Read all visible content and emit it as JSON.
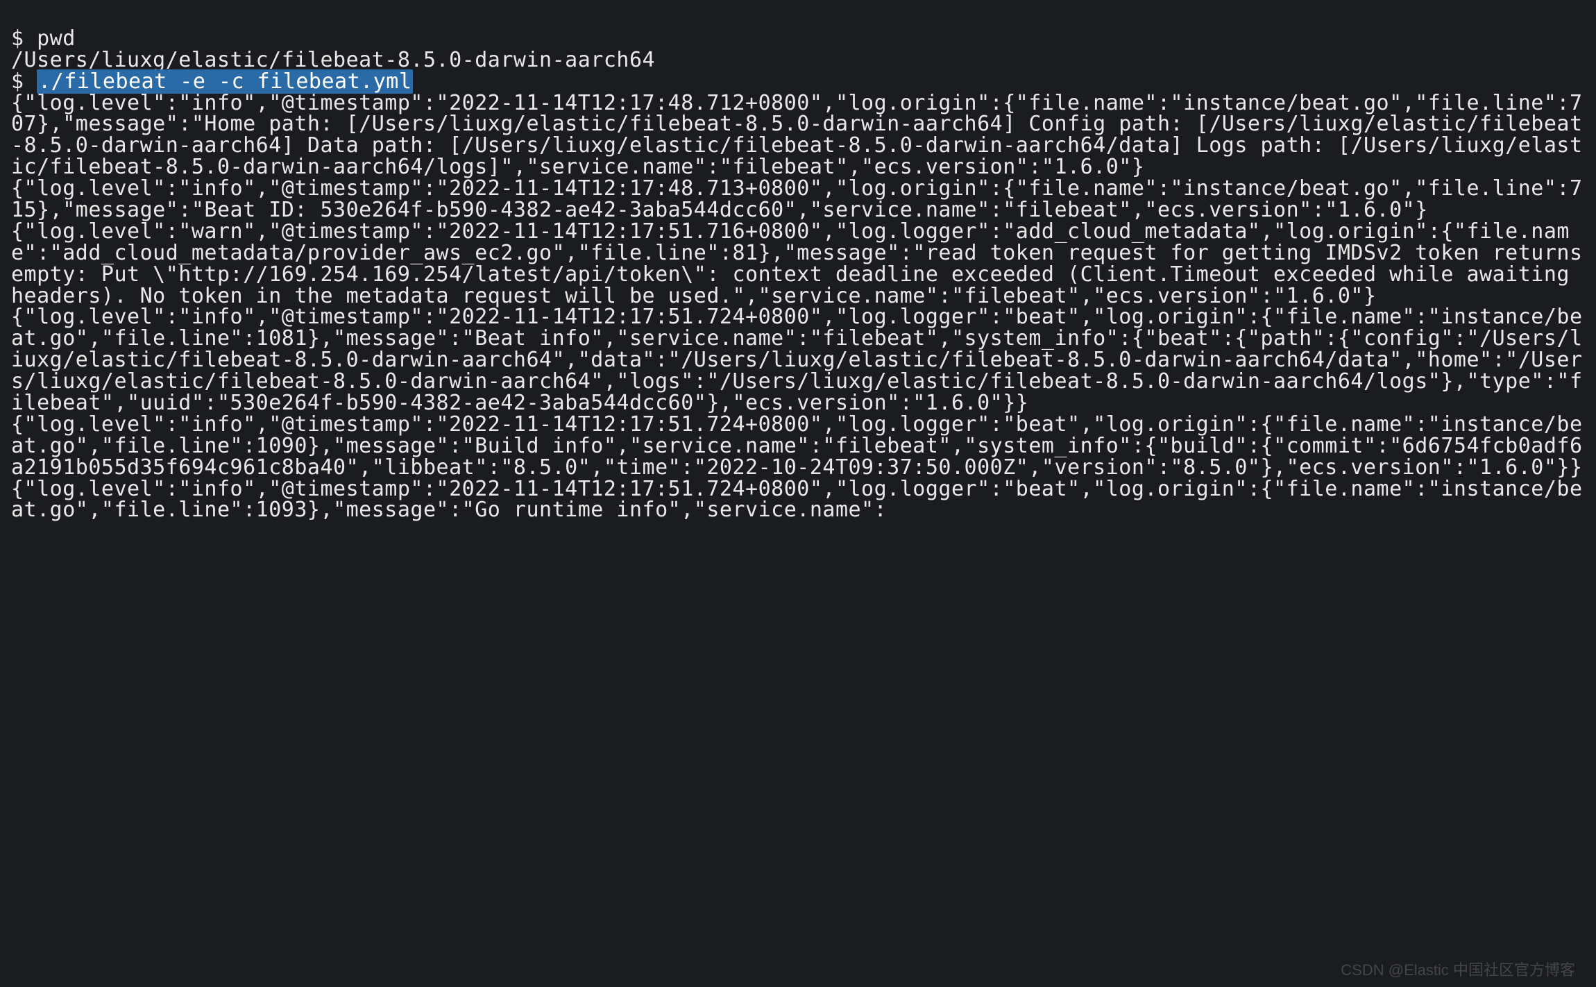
{
  "prompt": "$",
  "cmd_pwd": "pwd",
  "pwd_output": "/Users/liuxg/elastic/filebeat-8.5.0-darwin-aarch64",
  "cmd_filebeat": "./filebeat -e -c filebeat.yml",
  "logs": [
    "{\"log.level\":\"info\",\"@timestamp\":\"2022-11-14T12:17:48.712+0800\",\"log.origin\":{\"file.name\":\"instance/beat.go\",\"file.line\":707},\"message\":\"Home path: [/Users/liuxg/elastic/filebeat-8.5.0-darwin-aarch64] Config path: [/Users/liuxg/elastic/filebeat-8.5.0-darwin-aarch64] Data path: [/Users/liuxg/elastic/filebeat-8.5.0-darwin-aarch64/data] Logs path: [/Users/liuxg/elastic/filebeat-8.5.0-darwin-aarch64/logs]\",\"service.name\":\"filebeat\",\"ecs.version\":\"1.6.0\"}",
    "{\"log.level\":\"info\",\"@timestamp\":\"2022-11-14T12:17:48.713+0800\",\"log.origin\":{\"file.name\":\"instance/beat.go\",\"file.line\":715},\"message\":\"Beat ID: 530e264f-b590-4382-ae42-3aba544dcc60\",\"service.name\":\"filebeat\",\"ecs.version\":\"1.6.0\"}",
    "{\"log.level\":\"warn\",\"@timestamp\":\"2022-11-14T12:17:51.716+0800\",\"log.logger\":\"add_cloud_metadata\",\"log.origin\":{\"file.name\":\"add_cloud_metadata/provider_aws_ec2.go\",\"file.line\":81},\"message\":\"read token request for getting IMDSv2 token returns empty: Put \\\"http://169.254.169.254/latest/api/token\\\": context deadline exceeded (Client.Timeout exceeded while awaiting headers). No token in the metadata request will be used.\",\"service.name\":\"filebeat\",\"ecs.version\":\"1.6.0\"}",
    "{\"log.level\":\"info\",\"@timestamp\":\"2022-11-14T12:17:51.724+0800\",\"log.logger\":\"beat\",\"log.origin\":{\"file.name\":\"instance/beat.go\",\"file.line\":1081},\"message\":\"Beat info\",\"service.name\":\"filebeat\",\"system_info\":{\"beat\":{\"path\":{\"config\":\"/Users/liuxg/elastic/filebeat-8.5.0-darwin-aarch64\",\"data\":\"/Users/liuxg/elastic/filebeat-8.5.0-darwin-aarch64/data\",\"home\":\"/Users/liuxg/elastic/filebeat-8.5.0-darwin-aarch64\",\"logs\":\"/Users/liuxg/elastic/filebeat-8.5.0-darwin-aarch64/logs\"},\"type\":\"filebeat\",\"uuid\":\"530e264f-b590-4382-ae42-3aba544dcc60\"},\"ecs.version\":\"1.6.0\"}}",
    "{\"log.level\":\"info\",\"@timestamp\":\"2022-11-14T12:17:51.724+0800\",\"log.logger\":\"beat\",\"log.origin\":{\"file.name\":\"instance/beat.go\",\"file.line\":1090},\"message\":\"Build info\",\"service.name\":\"filebeat\",\"system_info\":{\"build\":{\"commit\":\"6d6754fcb0adf6a2191b055d35f694c961c8ba40\",\"libbeat\":\"8.5.0\",\"time\":\"2022-10-24T09:37:50.000Z\",\"version\":\"8.5.0\"},\"ecs.version\":\"1.6.0\"}}",
    "{\"log.level\":\"info\",\"@timestamp\":\"2022-11-14T12:17:51.724+0800\",\"log.logger\":\"beat\",\"log.origin\":{\"file.name\":\"instance/beat.go\",\"file.line\":1093},\"message\":\"Go runtime info\",\"service.name\":"
  ],
  "watermark": "CSDN @Elastic 中国社区官方博客"
}
